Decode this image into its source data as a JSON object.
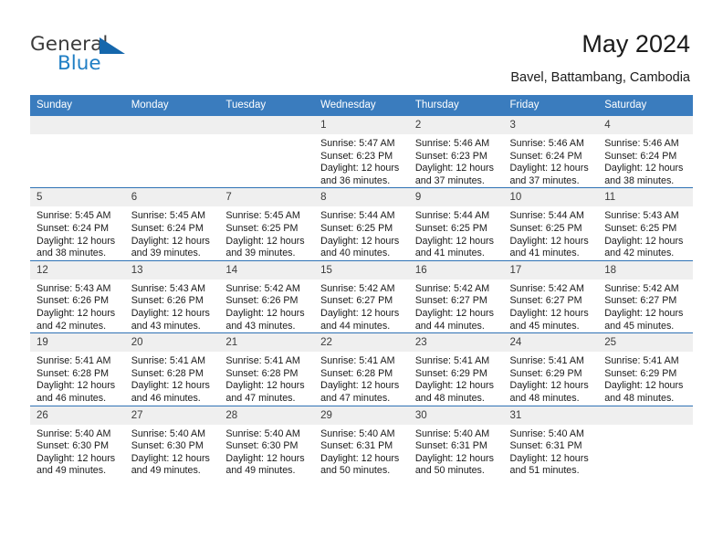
{
  "brand": {
    "name_part1": "General",
    "name_part2": "Blue",
    "logo_icon": "triangle-flag-icon",
    "accent_color": "#1567ac"
  },
  "header": {
    "title": "May 2024",
    "subtitle": "Bavel, Battambang, Cambodia"
  },
  "theme": {
    "header_row_bg": "#3a7cbe",
    "row_divider": "#2f72b5",
    "daynum_bg": "#efefef"
  },
  "calendar": {
    "weekday_headers": [
      "Sunday",
      "Monday",
      "Tuesday",
      "Wednesday",
      "Thursday",
      "Friday",
      "Saturday"
    ],
    "weeks": [
      [
        {
          "day": "",
          "lines": []
        },
        {
          "day": "",
          "lines": []
        },
        {
          "day": "",
          "lines": []
        },
        {
          "day": "1",
          "lines": [
            "Sunrise: 5:47 AM",
            "Sunset: 6:23 PM",
            "Daylight: 12 hours",
            "and 36 minutes."
          ]
        },
        {
          "day": "2",
          "lines": [
            "Sunrise: 5:46 AM",
            "Sunset: 6:23 PM",
            "Daylight: 12 hours",
            "and 37 minutes."
          ]
        },
        {
          "day": "3",
          "lines": [
            "Sunrise: 5:46 AM",
            "Sunset: 6:24 PM",
            "Daylight: 12 hours",
            "and 37 minutes."
          ]
        },
        {
          "day": "4",
          "lines": [
            "Sunrise: 5:46 AM",
            "Sunset: 6:24 PM",
            "Daylight: 12 hours",
            "and 38 minutes."
          ]
        }
      ],
      [
        {
          "day": "5",
          "lines": [
            "Sunrise: 5:45 AM",
            "Sunset: 6:24 PM",
            "Daylight: 12 hours",
            "and 38 minutes."
          ]
        },
        {
          "day": "6",
          "lines": [
            "Sunrise: 5:45 AM",
            "Sunset: 6:24 PM",
            "Daylight: 12 hours",
            "and 39 minutes."
          ]
        },
        {
          "day": "7",
          "lines": [
            "Sunrise: 5:45 AM",
            "Sunset: 6:25 PM",
            "Daylight: 12 hours",
            "and 39 minutes."
          ]
        },
        {
          "day": "8",
          "lines": [
            "Sunrise: 5:44 AM",
            "Sunset: 6:25 PM",
            "Daylight: 12 hours",
            "and 40 minutes."
          ]
        },
        {
          "day": "9",
          "lines": [
            "Sunrise: 5:44 AM",
            "Sunset: 6:25 PM",
            "Daylight: 12 hours",
            "and 41 minutes."
          ]
        },
        {
          "day": "10",
          "lines": [
            "Sunrise: 5:44 AM",
            "Sunset: 6:25 PM",
            "Daylight: 12 hours",
            "and 41 minutes."
          ]
        },
        {
          "day": "11",
          "lines": [
            "Sunrise: 5:43 AM",
            "Sunset: 6:25 PM",
            "Daylight: 12 hours",
            "and 42 minutes."
          ]
        }
      ],
      [
        {
          "day": "12",
          "lines": [
            "Sunrise: 5:43 AM",
            "Sunset: 6:26 PM",
            "Daylight: 12 hours",
            "and 42 minutes."
          ]
        },
        {
          "day": "13",
          "lines": [
            "Sunrise: 5:43 AM",
            "Sunset: 6:26 PM",
            "Daylight: 12 hours",
            "and 43 minutes."
          ]
        },
        {
          "day": "14",
          "lines": [
            "Sunrise: 5:42 AM",
            "Sunset: 6:26 PM",
            "Daylight: 12 hours",
            "and 43 minutes."
          ]
        },
        {
          "day": "15",
          "lines": [
            "Sunrise: 5:42 AM",
            "Sunset: 6:27 PM",
            "Daylight: 12 hours",
            "and 44 minutes."
          ]
        },
        {
          "day": "16",
          "lines": [
            "Sunrise: 5:42 AM",
            "Sunset: 6:27 PM",
            "Daylight: 12 hours",
            "and 44 minutes."
          ]
        },
        {
          "day": "17",
          "lines": [
            "Sunrise: 5:42 AM",
            "Sunset: 6:27 PM",
            "Daylight: 12 hours",
            "and 45 minutes."
          ]
        },
        {
          "day": "18",
          "lines": [
            "Sunrise: 5:42 AM",
            "Sunset: 6:27 PM",
            "Daylight: 12 hours",
            "and 45 minutes."
          ]
        }
      ],
      [
        {
          "day": "19",
          "lines": [
            "Sunrise: 5:41 AM",
            "Sunset: 6:28 PM",
            "Daylight: 12 hours",
            "and 46 minutes."
          ]
        },
        {
          "day": "20",
          "lines": [
            "Sunrise: 5:41 AM",
            "Sunset: 6:28 PM",
            "Daylight: 12 hours",
            "and 46 minutes."
          ]
        },
        {
          "day": "21",
          "lines": [
            "Sunrise: 5:41 AM",
            "Sunset: 6:28 PM",
            "Daylight: 12 hours",
            "and 47 minutes."
          ]
        },
        {
          "day": "22",
          "lines": [
            "Sunrise: 5:41 AM",
            "Sunset: 6:28 PM",
            "Daylight: 12 hours",
            "and 47 minutes."
          ]
        },
        {
          "day": "23",
          "lines": [
            "Sunrise: 5:41 AM",
            "Sunset: 6:29 PM",
            "Daylight: 12 hours",
            "and 48 minutes."
          ]
        },
        {
          "day": "24",
          "lines": [
            "Sunrise: 5:41 AM",
            "Sunset: 6:29 PM",
            "Daylight: 12 hours",
            "and 48 minutes."
          ]
        },
        {
          "day": "25",
          "lines": [
            "Sunrise: 5:41 AM",
            "Sunset: 6:29 PM",
            "Daylight: 12 hours",
            "and 48 minutes."
          ]
        }
      ],
      [
        {
          "day": "26",
          "lines": [
            "Sunrise: 5:40 AM",
            "Sunset: 6:30 PM",
            "Daylight: 12 hours",
            "and 49 minutes."
          ]
        },
        {
          "day": "27",
          "lines": [
            "Sunrise: 5:40 AM",
            "Sunset: 6:30 PM",
            "Daylight: 12 hours",
            "and 49 minutes."
          ]
        },
        {
          "day": "28",
          "lines": [
            "Sunrise: 5:40 AM",
            "Sunset: 6:30 PM",
            "Daylight: 12 hours",
            "and 49 minutes."
          ]
        },
        {
          "day": "29",
          "lines": [
            "Sunrise: 5:40 AM",
            "Sunset: 6:31 PM",
            "Daylight: 12 hours",
            "and 50 minutes."
          ]
        },
        {
          "day": "30",
          "lines": [
            "Sunrise: 5:40 AM",
            "Sunset: 6:31 PM",
            "Daylight: 12 hours",
            "and 50 minutes."
          ]
        },
        {
          "day": "31",
          "lines": [
            "Sunrise: 5:40 AM",
            "Sunset: 6:31 PM",
            "Daylight: 12 hours",
            "and 51 minutes."
          ]
        },
        {
          "day": "",
          "lines": []
        }
      ]
    ]
  }
}
